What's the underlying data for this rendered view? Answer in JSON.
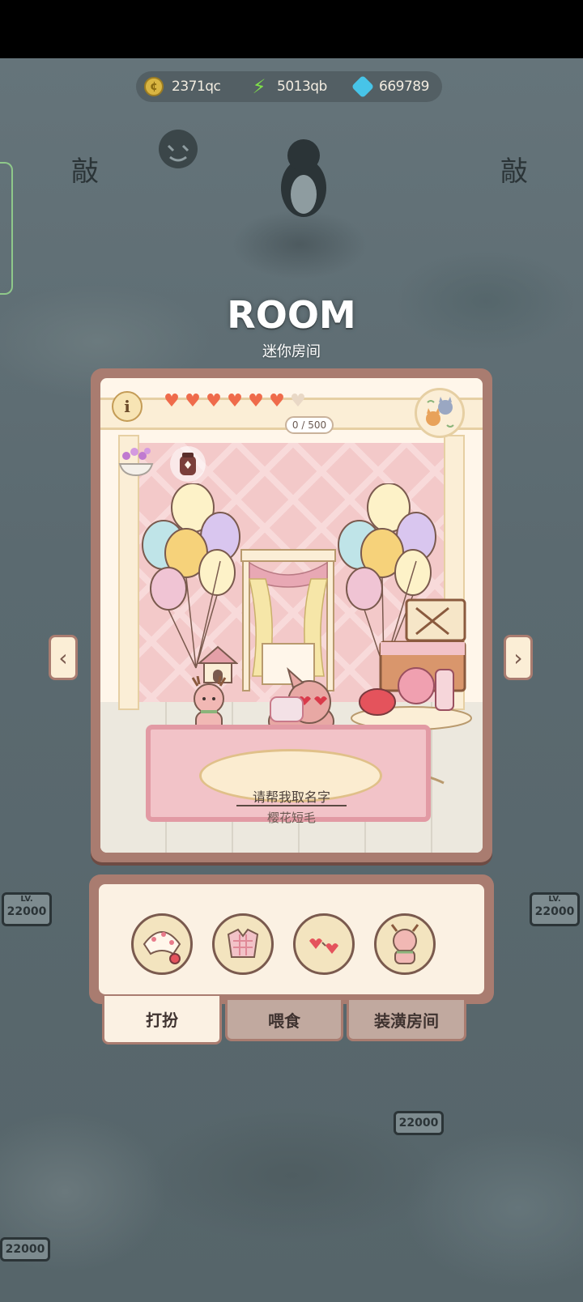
{
  "currency": {
    "coins": "2371qc",
    "energy": "5013qb",
    "gems": "669789"
  },
  "room": {
    "title": "ROOM",
    "subtitle": "迷你房间",
    "progress": "0 / 500",
    "hearts_filled": 6,
    "hearts_total": 7,
    "pet_name_prompt": "请帮我取名字",
    "pet_breed": "樱花短毛"
  },
  "tabs": {
    "dress_up": "打扮",
    "feed": "喂食",
    "decorate": "装潢房间"
  },
  "background": {
    "knock_left": "敲",
    "knock_right": "敲",
    "signs": [
      "LV.",
      "22000",
      "LV.",
      "22000",
      "22000",
      "22000"
    ]
  },
  "colors": {
    "frame": "#a97c70",
    "panel": "#fbf1e3",
    "heart": "#ef6b4b",
    "wall": "#f3c9c9"
  },
  "icons": {
    "info": "i"
  }
}
